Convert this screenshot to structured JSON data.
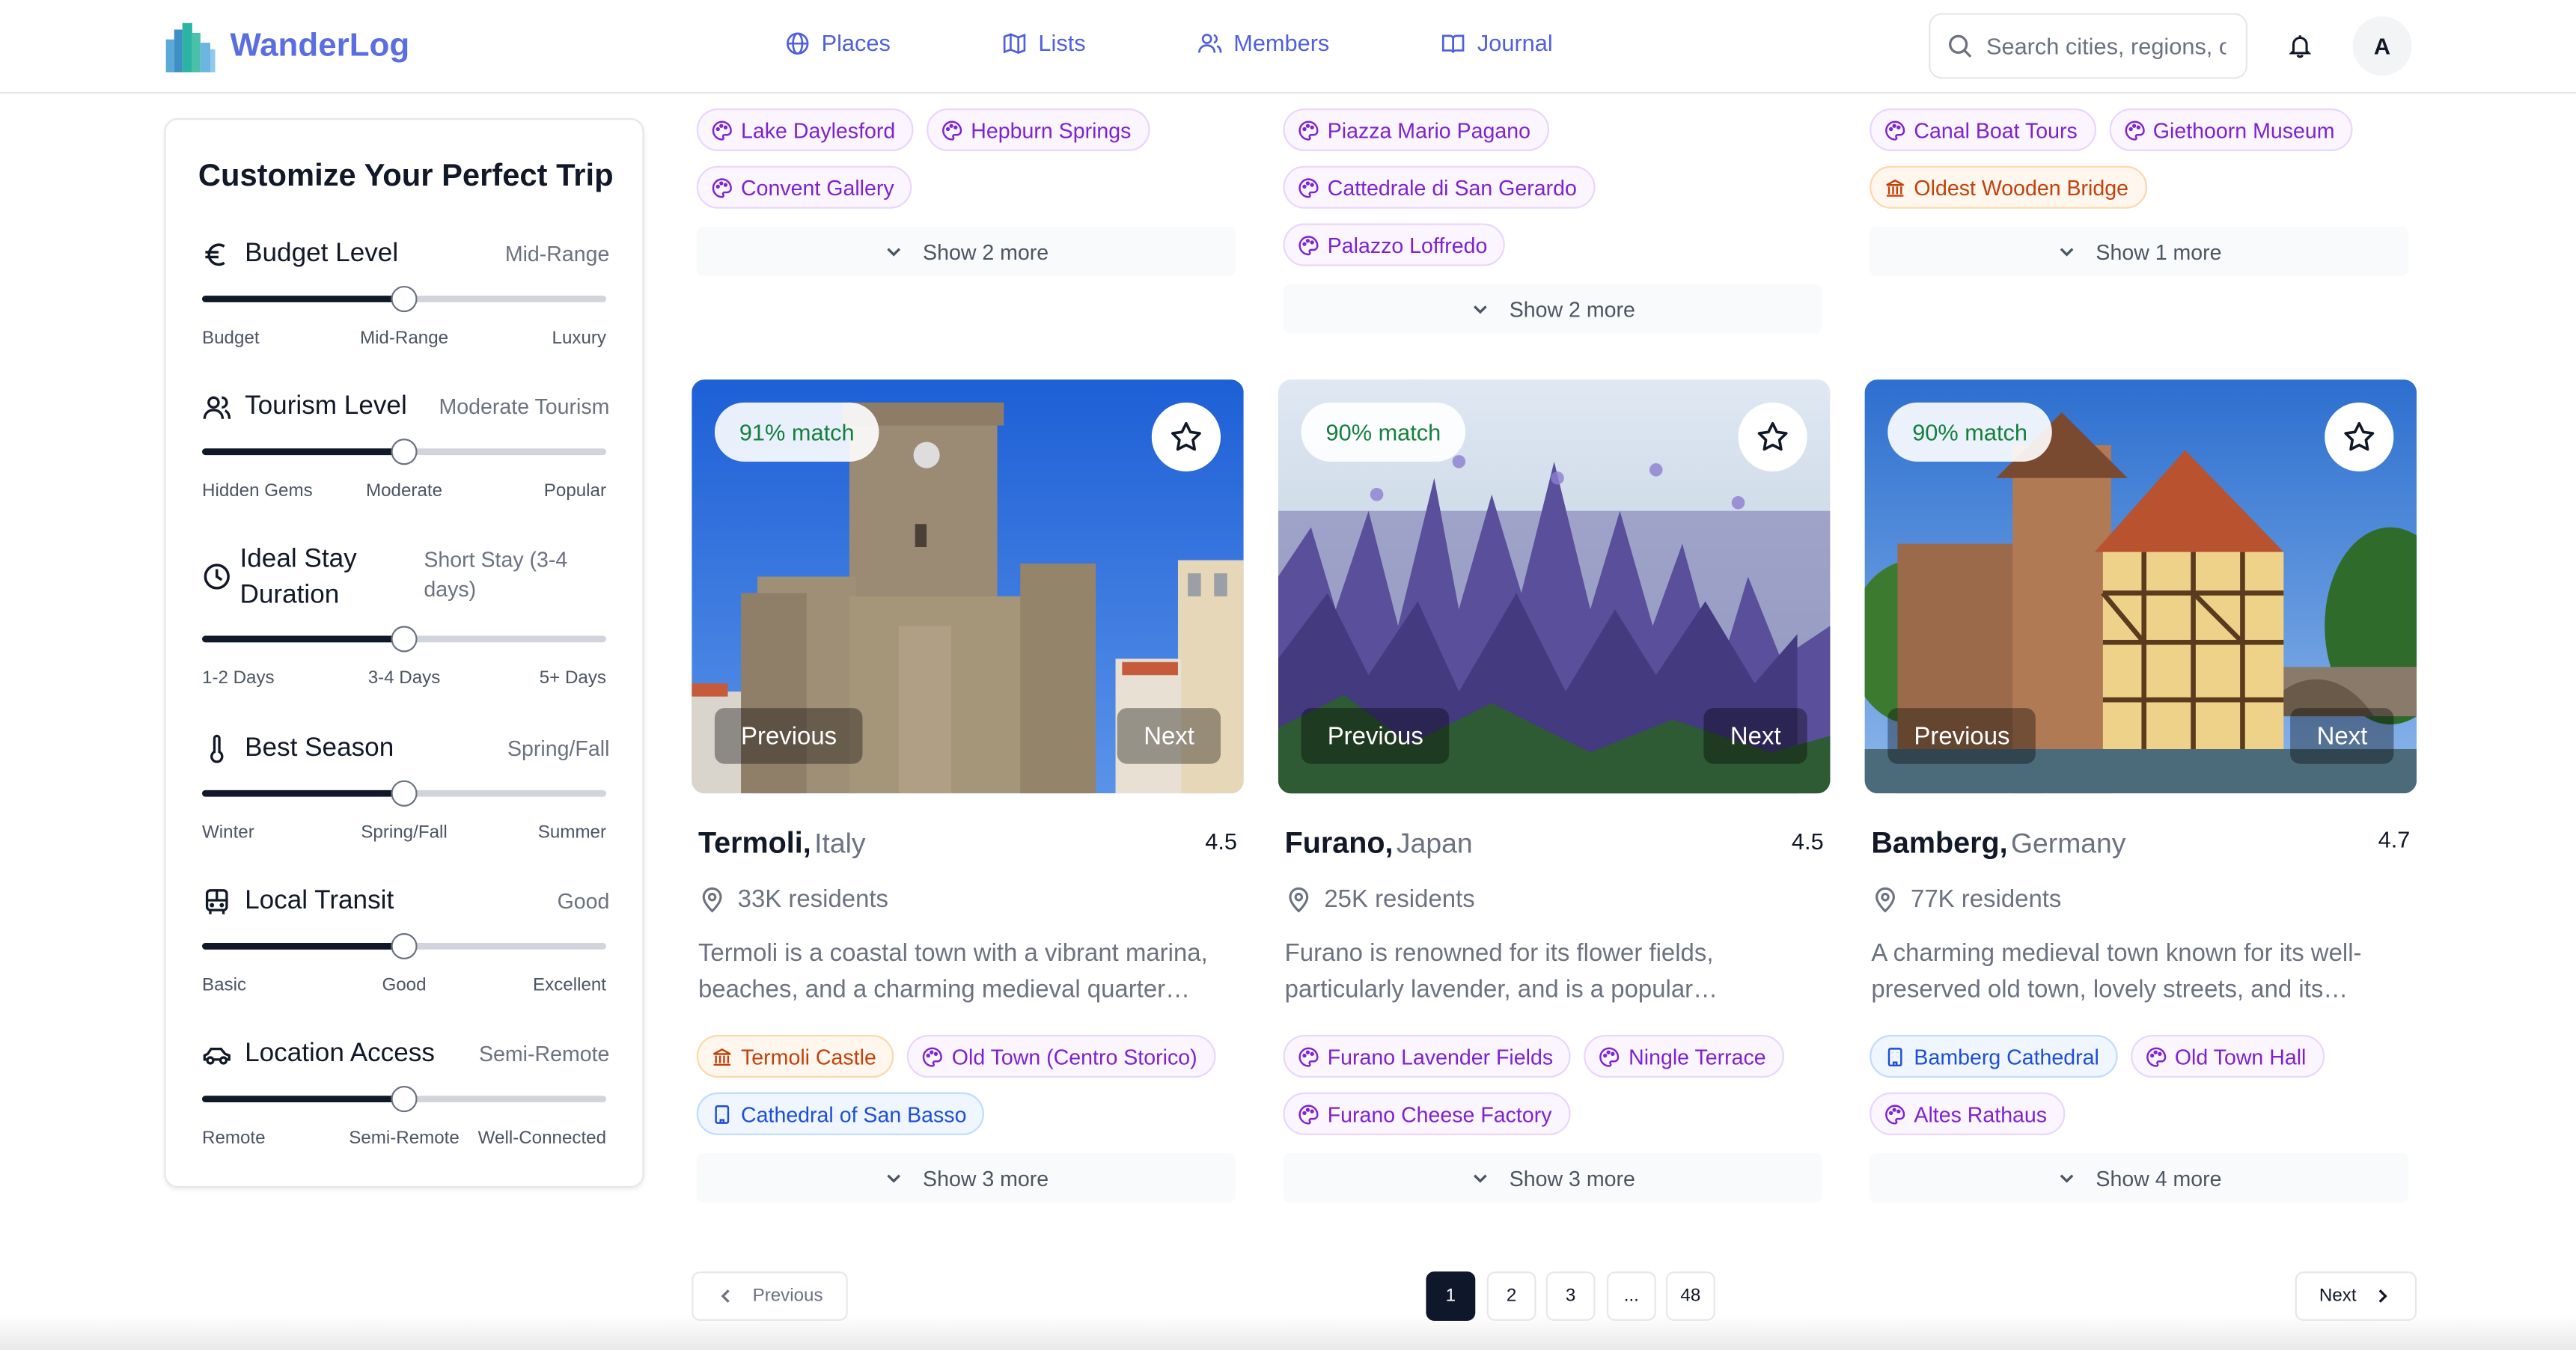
{
  "app": {
    "name": "WanderLog"
  },
  "nav": [
    {
      "label": "Places",
      "icon": "globe-icon"
    },
    {
      "label": "Lists",
      "icon": "map-icon"
    },
    {
      "label": "Members",
      "icon": "users-icon"
    },
    {
      "label": "Journal",
      "icon": "book-icon"
    }
  ],
  "search": {
    "placeholder": "Search cities, regions, o"
  },
  "user": {
    "initial": "A"
  },
  "sidebar": {
    "title": "Customize Your Perfect Trip",
    "filters": [
      {
        "label": "Budget Level",
        "value": "Mid-Range",
        "icon": "euro-icon",
        "level": 0.5,
        "ticks": [
          "Budget",
          "Mid-Range",
          "Luxury"
        ]
      },
      {
        "label": "Tourism Level",
        "value": "Moderate Tourism",
        "icon": "users-icon",
        "level": 0.5,
        "ticks": [
          "Hidden Gems",
          "Moderate",
          "Popular"
        ]
      },
      {
        "label": "Ideal Stay Duration",
        "value": "Short Stay (3-4 days)",
        "icon": "clock-icon",
        "level": 0.5,
        "ticks": [
          "1-2 Days",
          "3-4 Days",
          "5+ Days"
        ]
      },
      {
        "label": "Best Season",
        "value": "Spring/Fall",
        "icon": "thermometer-icon",
        "level": 0.5,
        "ticks": [
          "Winter",
          "Spring/Fall",
          "Summer"
        ]
      },
      {
        "label": "Local Transit",
        "value": "Good",
        "icon": "bus-icon",
        "level": 0.5,
        "ticks": [
          "Basic",
          "Good",
          "Excellent"
        ]
      },
      {
        "label": "Location Access",
        "value": "Semi-Remote",
        "icon": "car-icon",
        "level": 0.5,
        "ticks": [
          "Remote",
          "Semi-Remote",
          "Well-Connected"
        ]
      }
    ]
  },
  "top_cards": [
    {
      "tags": [
        {
          "label": "Lake Daylesford",
          "kind": "purple"
        },
        {
          "label": "Hepburn Springs",
          "kind": "purple"
        },
        {
          "label": "Convent Gallery",
          "kind": "purple"
        }
      ],
      "show_more": "Show 2 more"
    },
    {
      "tags": [
        {
          "label": "Piazza Mario Pagano",
          "kind": "purple"
        },
        {
          "label": "Cattedrale di San Gerardo",
          "kind": "purple"
        },
        {
          "label": "Palazzo Loffredo",
          "kind": "purple"
        }
      ],
      "show_more": "Show 2 more"
    },
    {
      "tags": [
        {
          "label": "Canal Boat Tours",
          "kind": "purple"
        },
        {
          "label": "Giethoorn Museum",
          "kind": "purple"
        },
        {
          "label": "Oldest Wooden Bridge",
          "kind": "orange"
        }
      ],
      "show_more": "Show 1 more"
    }
  ],
  "cards": [
    {
      "city": "Termoli,",
      "country": "Italy",
      "rating": "4.5",
      "match": "91% match",
      "residents": "33K residents",
      "description": "Termoli is a coastal town with a vibrant marina, beaches, and a charming medieval quarter…",
      "tags": [
        {
          "label": "Termoli Castle",
          "kind": "orange"
        },
        {
          "label": "Old Town (Centro Storico)",
          "kind": "purple"
        },
        {
          "label": "Cathedral of San Basso",
          "kind": "blue"
        }
      ],
      "show_more": "Show 3 more"
    },
    {
      "city": "Furano,",
      "country": "Japan",
      "rating": "4.5",
      "match": "90% match",
      "residents": "25K residents",
      "description": "Furano is renowned for its flower fields, particularly lavender, and is a popular…",
      "tags": [
        {
          "label": "Furano Lavender Fields",
          "kind": "purple"
        },
        {
          "label": "Ningle Terrace",
          "kind": "purple"
        },
        {
          "label": "Furano Cheese Factory",
          "kind": "purple"
        }
      ],
      "show_more": "Show 3 more"
    },
    {
      "city": "Bamberg,",
      "country": "Germany",
      "rating": "4.7",
      "match": "90% match",
      "residents": "77K residents",
      "description": "A charming medieval town known for its well-preserved old town, lovely streets, and its…",
      "tags": [
        {
          "label": "Bamberg Cathedral",
          "kind": "blue"
        },
        {
          "label": "Old Town Hall",
          "kind": "purple"
        },
        {
          "label": "Altes Rathaus",
          "kind": "purple"
        }
      ],
      "show_more": "Show 4 more"
    }
  ],
  "carousel": {
    "previous": "Previous",
    "next": "Next"
  },
  "pagination": {
    "previous": "Previous",
    "next": "Next",
    "pages": [
      "1",
      "2",
      "3",
      "...",
      "48"
    ],
    "current": "1"
  },
  "colors": {
    "brand": "#5b6ee1",
    "match_text": "#15803d",
    "active_page": "#0f172a"
  }
}
